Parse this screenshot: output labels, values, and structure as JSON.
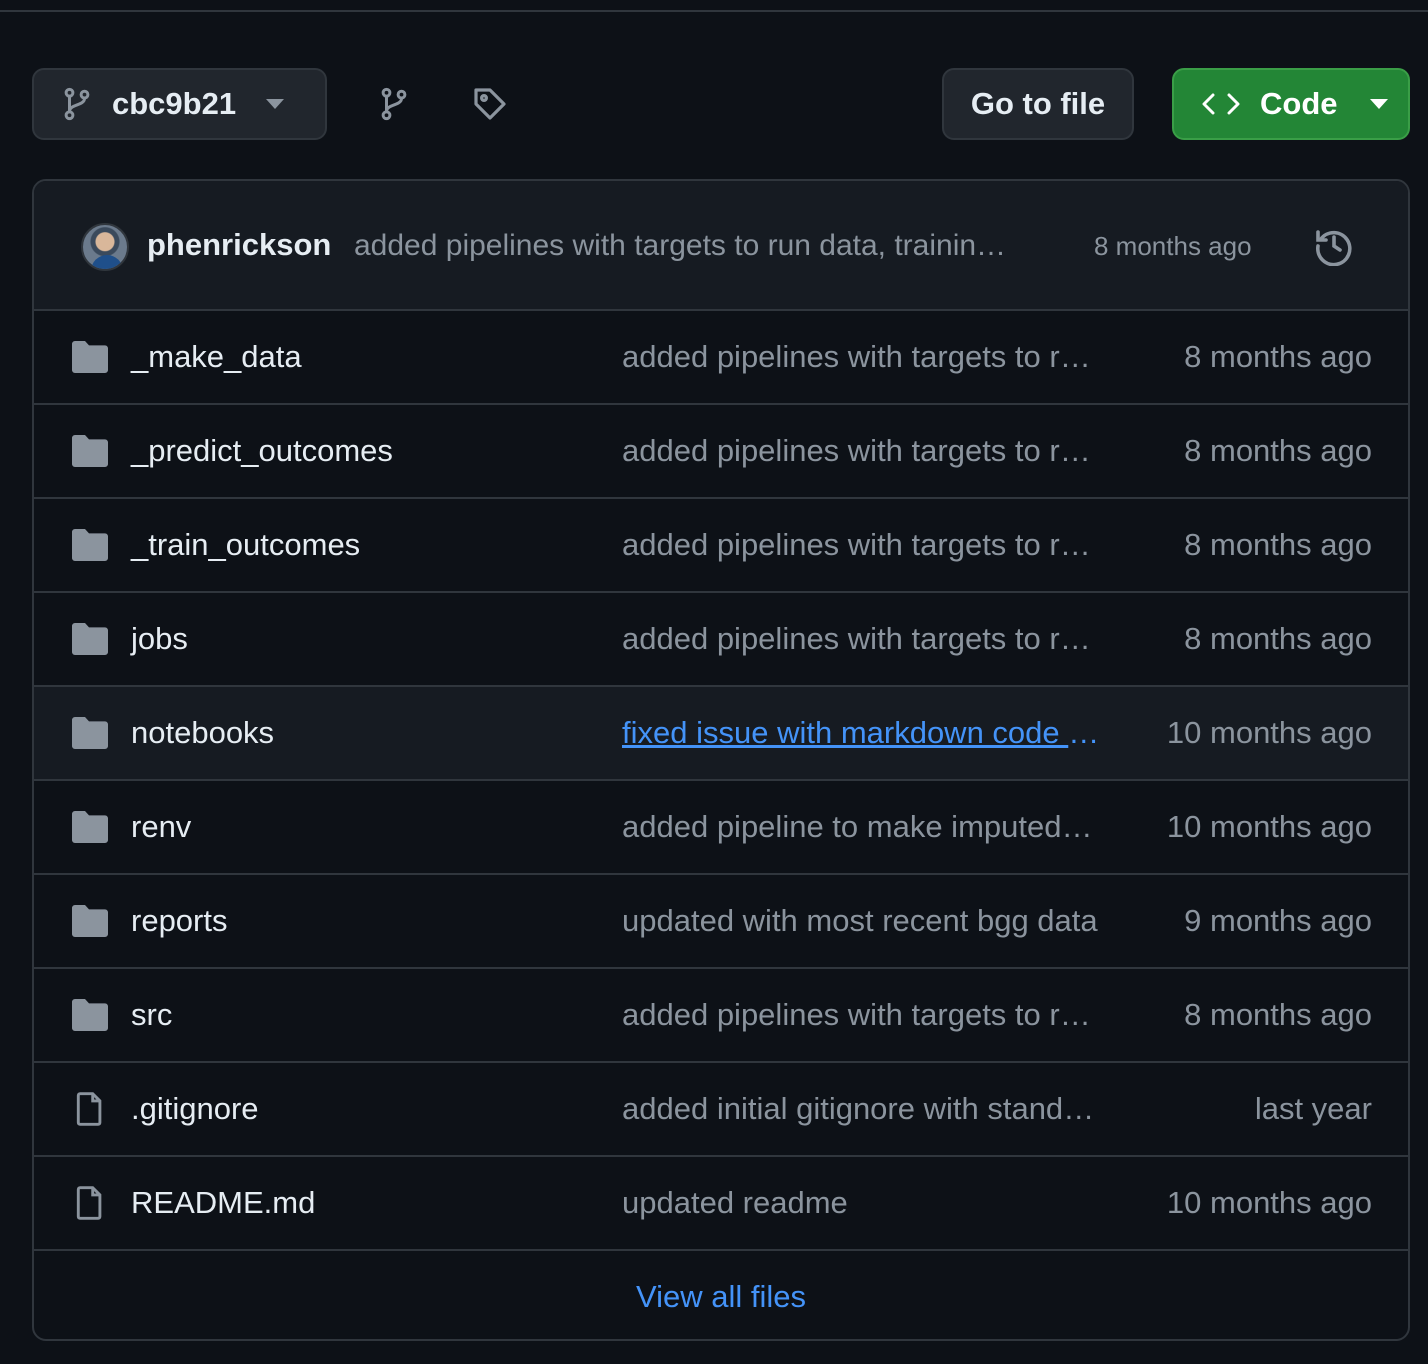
{
  "toolbar": {
    "branch_label": "cbc9b21",
    "goto_file_label": "Go to file",
    "code_label": "Code"
  },
  "commit": {
    "author": "phenrickson",
    "message": "added pipelines with targets to run data, trainin…",
    "time": "8 months ago"
  },
  "files": [
    {
      "name": "_make_data",
      "type": "folder",
      "message": "added pipelines with targets to run data, training",
      "time": "8 months ago"
    },
    {
      "name": "_predict_outcomes",
      "type": "folder",
      "message": "added pipelines with targets to run data, training",
      "time": "8 months ago"
    },
    {
      "name": "_train_outcomes",
      "type": "folder",
      "message": "added pipelines with targets to run data, training",
      "time": "8 months ago"
    },
    {
      "name": "jobs",
      "type": "folder",
      "message": "added pipelines with targets to run data, training",
      "time": "8 months ago"
    },
    {
      "name": "notebooks",
      "type": "folder",
      "message": "fixed issue with markdown code chunks",
      "time": "10 months ago"
    },
    {
      "name": "renv",
      "type": "folder",
      "message": "added pipeline to make imputed data",
      "time": "10 months ago"
    },
    {
      "name": "reports",
      "type": "folder",
      "message": "updated with most recent bgg data",
      "time": "9 months ago"
    },
    {
      "name": "src",
      "type": "folder",
      "message": "added pipelines with targets to run data, training",
      "time": "8 months ago"
    },
    {
      "name": ".gitignore",
      "type": "file",
      "message": "added initial gitignore with standard",
      "time": "last year"
    },
    {
      "name": "README.md",
      "type": "file",
      "message": "updated readme",
      "time": "10 months ago"
    }
  ],
  "view_all_label": "View all files",
  "colors": {
    "background": "#0d1117",
    "border": "#30363d",
    "accent_green": "#238636",
    "link_blue": "#4493f8",
    "muted_text": "#8b949e"
  }
}
